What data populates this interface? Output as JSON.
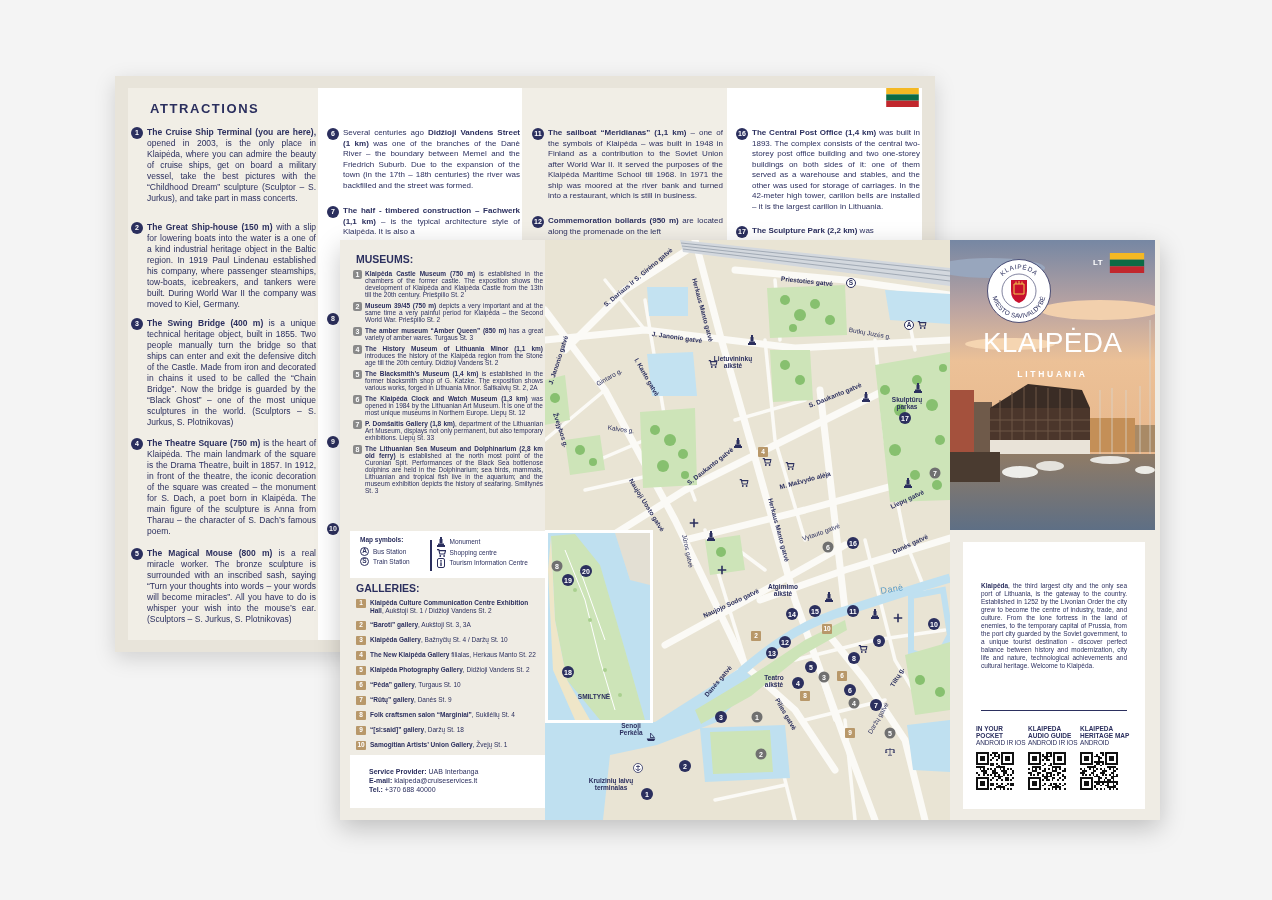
{
  "attractions_sheet": {
    "heading": "ATTRACTIONS",
    "columns": [
      {
        "items": [
          {
            "number": "1",
            "text": "**The Cruise Ship Terminal (you are here),** opened in 2003, is the only place in Klaipėda, where you can admire the beauty of cruise ships, get on board a military vessel, take the best pictures with the “Childhood Dream” sculpture (Sculptor – S. Jurkus), and take part in mass concerts."
          },
          {
            "number": "2",
            "text": "**The Great Ship-house (150 m)** with a slip for lowering boats into the water is a one of a kind industrial heritage object in the Baltic region. In 1919 Paul Lindenau established his company, where passenger steamships, tow-boats, icebreakers, and tankers were built. During World War II the company was moved to Kiel, Germany."
          },
          {
            "number": "3",
            "text": "**The Swing Bridge (400 m)** is a unique technical heritage object, built in 1855. Two people manually turn the bridge so that ships can enter and exit the defensive ditch of the Castle. Made from iron and decorated in chains it used to be called the “Chain Bridge”. Now the bridge is guarded by the “Black Ghost” – one of the most unique sculptures in the world. (Sculptors – S. Jurkus, S. Plotnikovas)"
          },
          {
            "number": "4",
            "text": "**The Theatre Square (750 m)** is the heart of Klaipėda. The main landmark of the square is the Drama Theatre, built in 1857. In 1912, in front of the theatre, the iconic decoration of the square was created – the monument for S. Dach, a poet born in Klaipėda. The main figure of the sculpture is Anna from Tharau – the character of S. Dach’s famous poem."
          },
          {
            "number": "5",
            "text": "**The Magical Mouse (800 m)** is a real miracle worker. The bronze sculpture is surrounded with an inscribed sash, saying “Turn your thoughts into words – your words will become miracles”. All you have to do is whisper your wish into the mouse’s ear. (Sculptors – S. Jurkus, S. Plotnikovas)"
          }
        ]
      },
      {
        "items": [
          {
            "number": "6",
            "text": "Several centuries ago **Didžioji Vandens Street (1 km)** was one of the branches of the Danė River – the boundary between Memel and the Friedrich Suburb. Due to the expansion of the town (in the 17th – 18th centuries) the river was backfilled and the street was formed."
          },
          {
            "number": "7",
            "text": "**The half - timbered construction – Fachwerk (1,1 km)** – is the typical architecture style of Klaipėda. It is also a"
          },
          {
            "number": "8"
          },
          {
            "number": "9"
          },
          {
            "number": "10"
          }
        ]
      },
      {
        "items": [
          {
            "number": "11",
            "text": "**The sailboat “Meridianas” (1,1 km)** – one of the symbols of Klaipėda – was built in 1948 in Finland as a contribution to the Soviet Union after World War II. It served the purposes of the Klaipėda Maritime School till 1968. In 1971 the ship was moored at the river bank and turned into a restaurant, which is still in business."
          },
          {
            "number": "12",
            "text": "**Commemoration bollards (950 m)** are located along the promenade on the left"
          }
        ]
      },
      {
        "items": [
          {
            "number": "16",
            "text": "**The Central Post Office (1,4 km)** was built in 1893. The complex consists of the central two-storey post office building and two one-storey buildings on both sides of it: one of them served as a warehouse and stables, and the other was used for storage of carriages. In the 42-meter high tower, carillon bells are installed – it is the largest carillon in Lithuania."
          },
          {
            "number": "17",
            "text": "**The Sculpture Park (2,2 km)** was"
          }
        ]
      }
    ]
  },
  "museums": {
    "heading": "MUSEUMS:",
    "items": [
      {
        "number": "1",
        "text": "**Klaipėda Castle Museum (750 m)** is established in the chambers of the former castle. The exposition shows the development of Klaipėda and Klaipėda Castle from the 13th till the 20th century. Priešpilio St. 2"
      },
      {
        "number": "2",
        "text": "**Museum 39/45 (750 m)** depicts a very important and at the same time a very painful period for Klaipėda – the Second World War. Priešpilio St. 2"
      },
      {
        "number": "3",
        "text": "**The amber museum “Amber Queen” (850 m)** has a great variety of amber wares. Turgaus St. 3"
      },
      {
        "number": "4",
        "text": "**The History Museum of Lithuania Minor (1,1 km)** introduces the history of the Klaipėda region from the Stone age till the 20th century. Didžioji Vandens St. 2"
      },
      {
        "number": "5",
        "text": "**The Blacksmith’s Museum (1,4 km)** is established in the former blacksmith shop of G. Katzke. The exposition shows various works, forged in Lithuania Minor. Šaltkalvių St. 2, 2A"
      },
      {
        "number": "6",
        "text": "**The Klaipėda Clock and Watch Museum (1,3 km)** was opened in 1984 by the Lithuanian Art Museum. It is one of the most unique museums in Northern Europe. Liepų St. 12"
      },
      {
        "number": "7",
        "text": "**P. Domšaitis Gallery (1,8 km)**, department of the Lithuanian Art Museum, displays not only permanent, but also temporary exhibitions. Liepų St. 33"
      },
      {
        "number": "8",
        "text": "**The Lithuanian Sea Museum and Dolphinarium (2,8 km old ferry)** is established at the north most point of the Curonian Spit. Performances of the Black Sea bottlenose dolphins are held in the Dolphinarium; sea birds, mammals, Lithuanian and tropical fish live in the aquarium; and the museum exhibition depicts the history of seafaring. Smiltynės St. 3"
      }
    ]
  },
  "map_symbols": {
    "heading": "Map symbols:",
    "stations": [
      {
        "symbol": "A",
        "label": "Bus Station"
      },
      {
        "symbol": "S",
        "label": "Train Station"
      }
    ],
    "places": [
      {
        "kind": "monument",
        "label": "Monument"
      },
      {
        "kind": "shopping",
        "label": "Shopping centre"
      },
      {
        "kind": "info",
        "label": "Tourism Information Centre"
      }
    ]
  },
  "galleries": {
    "heading": "GALLERIES:",
    "items": [
      {
        "number": "1",
        "text": "**Klaipėda Culture Communication Centre Exhibition Hall**, Aukštoji St. 1 / Didžioji Vandens St. 2"
      },
      {
        "number": "2",
        "text": "**“Baroti” gallery**, Aukštoji St. 3, 3A"
      },
      {
        "number": "3",
        "text": "**Klaipėda Gallery**, Bažnyčių St. 4 / Daržų St. 10"
      },
      {
        "number": "4",
        "text": "**The New Klaipėda Gallery** filialas, Herkaus Manto St. 22"
      },
      {
        "number": "5",
        "text": "**Klaipėda Photography Gallery**, Didžioji Vandens St. 2"
      },
      {
        "number": "6",
        "text": "**“Pėda” gallery**, Turgaus St. 10"
      },
      {
        "number": "7",
        "text": "**“Rūtų” gallery**, Danės St. 9"
      },
      {
        "number": "8",
        "text": "**Folk craftsmen salon “Marginiai”**, Sukilėlių St. 4"
      },
      {
        "number": "9",
        "text": "**“[si:said]” gallery**, Daržų St. 18"
      },
      {
        "number": "10",
        "text": "**Samogitian Artists’ Union Gallery**, Žvejų St. 1"
      }
    ]
  },
  "service": [
    "**Service Provider:** UAB Interbanga",
    "**E-mail:** klaipeda@cruiseservices.lt",
    "**Tel.:** +370 688 40000"
  ],
  "map": {
    "labels": [
      {
        "kind": "street",
        "text": "S. Dariaus ir S. Girėno gatvė"
      },
      {
        "kind": "street",
        "text": "Priestoties gatvė"
      },
      {
        "kind": "street",
        "text": "Herkaus Manto gatvė"
      },
      {
        "kind": "lane",
        "text": "Butkų Juzės g."
      },
      {
        "kind": "street",
        "text": "J. Janonio gatvė"
      },
      {
        "kind": "street",
        "text": "J. Janonio gatvė"
      },
      {
        "kind": "square",
        "text": "Lietuvininkų aikštė"
      },
      {
        "kind": "lane",
        "text": "Gintaro g."
      },
      {
        "kind": "street",
        "text": "I. Kanto gatvė"
      },
      {
        "kind": "street",
        "text": "S. Daukanto gatvė"
      },
      {
        "kind": "square",
        "text": "Skulptūrų parkas"
      },
      {
        "kind": "street",
        "text": "Žvejybos g."
      },
      {
        "kind": "lane",
        "text": "Kalvos g."
      },
      {
        "kind": "street",
        "text": "S. Daukanto gatvė"
      },
      {
        "kind": "street",
        "text": "M. Mažvydo alėja"
      },
      {
        "kind": "street",
        "text": "Liepų gatvė"
      },
      {
        "kind": "street",
        "text": "Naujoji Uosto gatvė"
      },
      {
        "kind": "street",
        "text": "Herkaus Manto gatvė"
      },
      {
        "kind": "lane",
        "text": "Vytauto gatvė"
      },
      {
        "kind": "street",
        "text": "Danės gatvė"
      },
      {
        "kind": "lane",
        "text": "Jūros gatvė"
      },
      {
        "kind": "street",
        "text": "Naujojo Sodo gatvė"
      },
      {
        "kind": "square",
        "text": "Atgimimo aikštė"
      },
      {
        "kind": "river",
        "text": "Danė"
      },
      {
        "kind": "street",
        "text": "Danės gatvė"
      },
      {
        "kind": "square",
        "text": "Teatro aikštė"
      },
      {
        "kind": "street",
        "text": "Tiltų g."
      },
      {
        "kind": "area",
        "text": "SMILTYNĖ"
      },
      {
        "kind": "street",
        "text": "Pilies gatvė"
      },
      {
        "kind": "lane",
        "text": "Daržų gatvė"
      },
      {
        "kind": "square",
        "text": "Senoji Perkėla"
      },
      {
        "kind": "square",
        "text": "Kruizinių laivų terminalas"
      }
    ],
    "markers": [
      {
        "kind": "attraction",
        "label": "1"
      },
      {
        "kind": "attraction",
        "label": "2"
      },
      {
        "kind": "attraction",
        "label": "3"
      },
      {
        "kind": "attraction",
        "label": "4"
      },
      {
        "kind": "attraction",
        "label": "5"
      },
      {
        "kind": "attraction",
        "label": "6"
      },
      {
        "kind": "attraction",
        "label": "7"
      },
      {
        "kind": "attraction",
        "label": "8"
      },
      {
        "kind": "attraction",
        "label": "9"
      },
      {
        "kind": "attraction",
        "label": "10"
      },
      {
        "kind": "attraction",
        "label": "11"
      },
      {
        "kind": "attraction",
        "label": "12"
      },
      {
        "kind": "attraction",
        "label": "13"
      },
      {
        "kind": "attraction",
        "label": "14"
      },
      {
        "kind": "attraction",
        "label": "15"
      },
      {
        "kind": "attraction",
        "label": "16"
      },
      {
        "kind": "attraction",
        "label": "17"
      },
      {
        "kind": "attraction",
        "label": "18"
      },
      {
        "kind": "attraction",
        "label": "19"
      },
      {
        "kind": "attraction",
        "label": "20"
      },
      {
        "kind": "museum",
        "label": "1"
      },
      {
        "kind": "museum",
        "label": "2"
      },
      {
        "kind": "museum",
        "label": "3"
      },
      {
        "kind": "museum",
        "label": "4"
      },
      {
        "kind": "museum",
        "label": "5"
      },
      {
        "kind": "museum",
        "label": "6"
      },
      {
        "kind": "museum",
        "label": "7"
      },
      {
        "kind": "museum",
        "label": "8"
      },
      {
        "kind": "gallery",
        "label": "4"
      },
      {
        "kind": "gallery",
        "label": "2"
      },
      {
        "kind": "gallery",
        "label": "10"
      },
      {
        "kind": "gallery",
        "label": "8"
      },
      {
        "kind": "gallery",
        "label": "6"
      },
      {
        "kind": "gallery",
        "label": "9"
      }
    ],
    "stations": [
      {
        "symbol": "S"
      },
      {
        "symbol": "A"
      }
    ]
  },
  "cover": {
    "language": "LT",
    "seal_top": "KLAIPĖDA",
    "seal_bottom": "MIESTO SAVIVALDYBĖ",
    "title": "KLAIPĖDA",
    "subtitle": "LITHUANIA",
    "intro": "**Klaipėda**, the third largest city and the only sea port of Lithuania, is the gateway to the country. Established in 1252 by the Livonian Order the city grew to become the centre of industry, trade, and culture. From the lone fortress in the land of enemies, to the temporary capital of Prussia, from the port city guarded by the Soviet government, to a unique tourist destination - discover perfect balance between history and modernization, city life and nature, technological achievements and cultural heritage. Welcome to Klaipėda.",
    "apps": [
      {
        "title": "IN YOUR POCKET",
        "platforms": "ANDROID IR IOS"
      },
      {
        "title": "KLAIPEDA AUDIO GUIDE",
        "platforms": "ANDROID IR IOS"
      },
      {
        "title": "KLAIPEDA HERITAGE MAP",
        "platforms": "ANDROID"
      }
    ]
  }
}
